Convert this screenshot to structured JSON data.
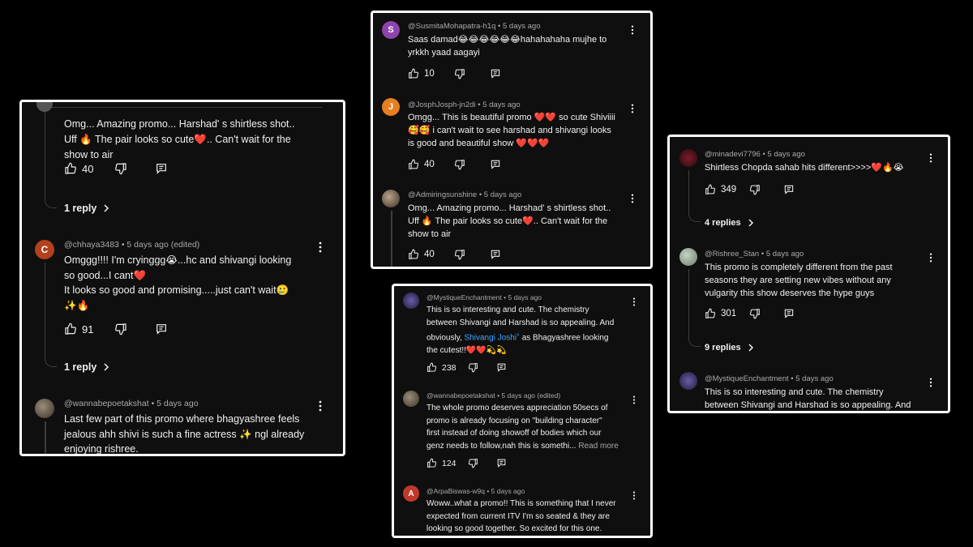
{
  "panel1": {
    "c1": {
      "text1": "Omg... Amazing promo... Harshad' s shirtless shot..",
      "text2": "Uff 🔥 The pair looks so cute❤️.. Can't wait for the",
      "text3": "show to air",
      "likes": "40",
      "replies": "1 reply"
    },
    "c2": {
      "initial": "C",
      "handle": "@chhaya3483",
      "time": "• 5 days ago (edited)",
      "text1": "Omggg!!!! I'm cryinggg😭...hc and shivangi looking",
      "text2": "so good...I cant❤️",
      "text3": "It looks so good and promising.....just can't wait🥲",
      "text4": "✨🔥",
      "likes": "91",
      "replies": "1 reply"
    },
    "c3": {
      "handle": "@wannabepoetakshat",
      "time": "• 5 days ago",
      "text1": "Last few part of this promo where bhagyashree feels",
      "text2": "jealous ahh shivi is such a fine actress ✨ ngl already",
      "text3": "enjoying rishree."
    }
  },
  "panel2": {
    "c1": {
      "initial": "S",
      "handle": "@SusmitaMohapatra-h1q",
      "time": "• 5 days ago",
      "text1": "Saas damad😂😂😂😂😂😂hahahahaha mujhe to",
      "text2": "yrkkh yaad aagayi",
      "likes": "10"
    },
    "c2": {
      "initial": "J",
      "handle": "@JosphJosph-jn2di",
      "time": "• 5 days ago",
      "text1": "Omgg... This is beautiful promo ❤️❤️ so cute Shiviiii",
      "text2": "🥰🥰 i can't wait to see harshad and shivangi looks",
      "text3": "is good and beautiful show ❤️❤️❤️",
      "likes": "40"
    },
    "c3": {
      "handle": "@Admiringsunshine",
      "time": "• 5 days ago",
      "text1": "Omg... Amazing promo... Harshad' s shirtless shot..",
      "text2": "Uff 🔥 The pair looks so cute❤️.. Can't wait for the",
      "text3": "show to air",
      "likes": "40"
    }
  },
  "panel3": {
    "c1": {
      "handle": "@MystiqueEnchantment",
      "time": "• 5 days ago",
      "text1": "This is so interesting and cute. The chemistry",
      "text2": "between Shivangi and Harshad is so appealing.  And",
      "text3a": "obviously, ",
      "link": "Shivangi Joshi",
      "text3b": " as Bhagyashree looking",
      "text4": "the cutest!!❤️❤️💫💫",
      "likes": "238"
    },
    "c2": {
      "handle": "@wannabepoetakshat",
      "time": "• 5 days ago (edited)",
      "text1": "The whole promo deserves appreciation 50secs of",
      "text2": "promo is already focusing on \"building character\"",
      "text3": "first instead of doing showoff of bodies which our",
      "text4": "genz needs to follow,nah this is somethi...",
      "readmore": "Read more",
      "likes": "124"
    },
    "c3": {
      "initial": "A",
      "handle": "@ArpaBiswas-w9q",
      "time": "• 5 days ago",
      "text1": "Woww..what a promo!! This is something that I never",
      "text2": "expected from current ITV I'm so seated & they are",
      "text3": "looking so good together. So excited for this one."
    }
  },
  "panel4": {
    "c1": {
      "handle": "@minadevi7796",
      "time": "• 5 days ago",
      "text1": "Shirtless Chopda sahab hits different>>>>❤️🔥😭",
      "likes": "349",
      "replies": "4 replies"
    },
    "c2": {
      "handle": "@Rishree_Stan",
      "time": "• 5 days ago",
      "text1": "This promo is completely different from the past",
      "text2": "seasons they are setting new vibes without any",
      "text3": "vulgarity this show deserves the hype guys",
      "likes": "301",
      "replies": "9 replies"
    },
    "c3": {
      "handle": "@MystiqueEnchantment",
      "time": "• 5 days ago",
      "text1": "This is so interesting and cute. The chemistry",
      "text2": "between Shivangi and Harshad is so appealing.  And"
    }
  },
  "colors": {
    "background": "#000000",
    "panel": "#0f0f0f",
    "border": "#ffffff",
    "link": "#3ea6ff",
    "avatar_c": "#b3411e",
    "avatar_s": "#8e44ad",
    "avatar_j": "#e67e22",
    "avatar_a": "#c0392b"
  }
}
